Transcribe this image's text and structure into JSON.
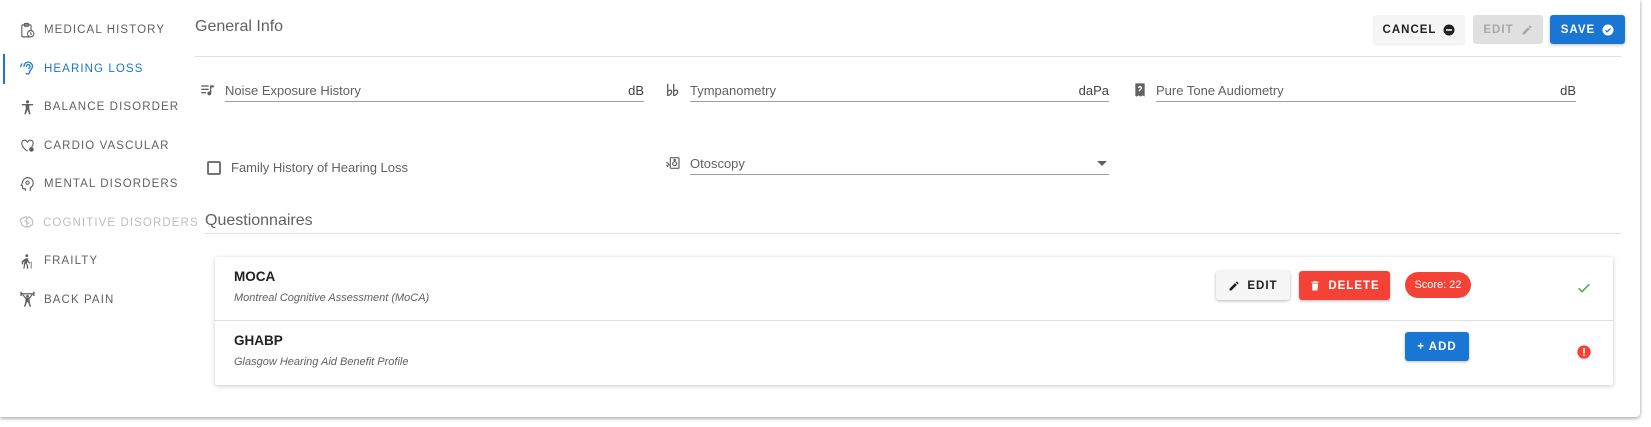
{
  "sidebar": {
    "items": [
      {
        "label": "MEDICAL HISTORY",
        "icon": "clipboard-clock-icon"
      },
      {
        "label": "HEARING LOSS",
        "icon": "ear-icon"
      },
      {
        "label": "BALANCE DISORDER",
        "icon": "person-balance-icon"
      },
      {
        "label": "CARDIO VASCULAR",
        "icon": "heart-gear-icon"
      },
      {
        "label": "MENTAL DISORDERS",
        "icon": "head-gear-icon"
      },
      {
        "label": "COGNITIVE DISORDERS",
        "icon": "brain-icon"
      },
      {
        "label": "FRAILTY",
        "icon": "walking-cane-icon"
      },
      {
        "label": "BACK PAIN",
        "icon": "weightlifter-icon"
      }
    ],
    "active_index": 1,
    "disabled_index": 5
  },
  "header": {
    "title": "General Info",
    "cancel_label": "CANCEL",
    "edit_label": "EDIT",
    "save_label": "SAVE"
  },
  "fields": {
    "noise_label": "Noise Exposure History",
    "noise_unit": "dB",
    "tympanometry_label": "Tympanometry",
    "tympanometry_unit": "daPa",
    "pta_label": "Pure Tone Audiometry",
    "pta_unit": "dB",
    "family_history_label": "Family History of Hearing Loss",
    "otoscopy_label": "Otoscopy"
  },
  "questionnaires": {
    "title": "Questionnaires",
    "items": [
      {
        "name": "MOCA",
        "description": "Montreal Cognitive Assessment (MoCA)",
        "edit_label": "EDIT",
        "delete_label": "DELETE",
        "score": "Score: 22",
        "status": "complete"
      },
      {
        "name": "GHABP",
        "description": "Glasgow Hearing Aid Benefit Profile",
        "add_label": "+ ADD",
        "status": "incomplete"
      }
    ]
  },
  "colors": {
    "primary": "#1976d2",
    "danger": "#f44336",
    "success": "#4caf50"
  }
}
